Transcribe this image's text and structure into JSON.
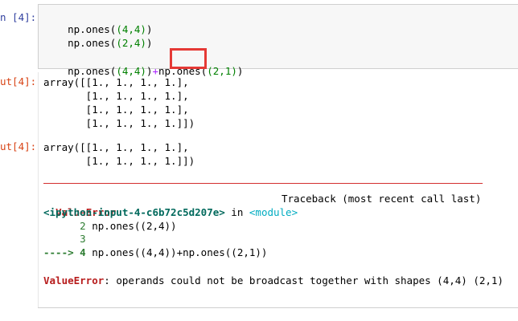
{
  "input": {
    "prompt": "n [4]:",
    "line1_a": "np.ones(",
    "line1_b": "(4,4)",
    "line1_c": ")",
    "line2_a": "np.ones(",
    "line2_b": "(2,4)",
    "line2_c": ")",
    "line4_a": "np.ones(",
    "line4_b": "(4,4)",
    "line4_c": ")",
    "line4_op": "+",
    "line4_d": "np.ones(",
    "line4_e": "(2,1)",
    "line4_f": ")"
  },
  "output1": {
    "prompt": "ut[4]:",
    "lines": [
      "array([[1., 1., 1., 1.],",
      "       [1., 1., 1., 1.],",
      "       [1., 1., 1., 1.],",
      "       [1., 1., 1., 1.]])"
    ]
  },
  "output2": {
    "prompt": "ut[4]:",
    "lines": [
      "array([[1., 1., 1., 1.],",
      "       [1., 1., 1., 1.]])"
    ]
  },
  "error": {
    "name": "ValueError",
    "traceback_label": "Traceback (most recent call last)",
    "source": "<ipython-input-4-c6b72c5d207e>",
    "in_word": " in ",
    "module": "<module>",
    "tb_line2_num": "      2",
    "tb_line2_code": " np.ones((2,4))",
    "tb_line3_num": "      3",
    "tb_arrow": "----> 4",
    "tb_line4_code": " np.ones((4,4))+np.ones((2,1))",
    "final_name": "ValueError",
    "final_msg": ": operands could not be broadcast together with shapes (4,4) (2,1)"
  }
}
